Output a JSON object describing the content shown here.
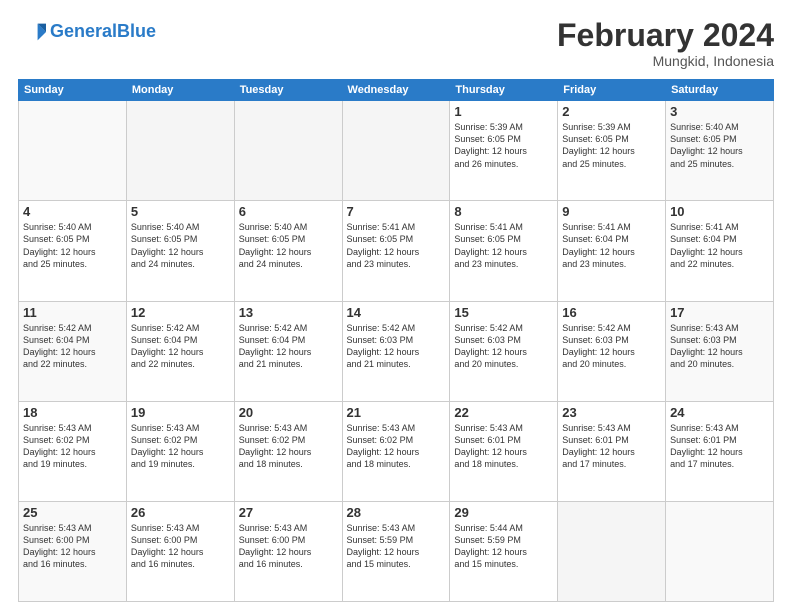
{
  "header": {
    "logo_text_general": "General",
    "logo_text_blue": "Blue",
    "month": "February 2024",
    "location": "Mungkid, Indonesia"
  },
  "days_of_week": [
    "Sunday",
    "Monday",
    "Tuesday",
    "Wednesday",
    "Thursday",
    "Friday",
    "Saturday"
  ],
  "weeks": [
    [
      {
        "day": "",
        "info": "",
        "empty": true
      },
      {
        "day": "",
        "info": "",
        "empty": true
      },
      {
        "day": "",
        "info": "",
        "empty": true
      },
      {
        "day": "",
        "info": "",
        "empty": true
      },
      {
        "day": "1",
        "info": "Sunrise: 5:39 AM\nSunset: 6:05 PM\nDaylight: 12 hours\nand 26 minutes.",
        "empty": false
      },
      {
        "day": "2",
        "info": "Sunrise: 5:39 AM\nSunset: 6:05 PM\nDaylight: 12 hours\nand 25 minutes.",
        "empty": false
      },
      {
        "day": "3",
        "info": "Sunrise: 5:40 AM\nSunset: 6:05 PM\nDaylight: 12 hours\nand 25 minutes.",
        "empty": false
      }
    ],
    [
      {
        "day": "4",
        "info": "Sunrise: 5:40 AM\nSunset: 6:05 PM\nDaylight: 12 hours\nand 25 minutes.",
        "empty": false
      },
      {
        "day": "5",
        "info": "Sunrise: 5:40 AM\nSunset: 6:05 PM\nDaylight: 12 hours\nand 24 minutes.",
        "empty": false
      },
      {
        "day": "6",
        "info": "Sunrise: 5:40 AM\nSunset: 6:05 PM\nDaylight: 12 hours\nand 24 minutes.",
        "empty": false
      },
      {
        "day": "7",
        "info": "Sunrise: 5:41 AM\nSunset: 6:05 PM\nDaylight: 12 hours\nand 23 minutes.",
        "empty": false
      },
      {
        "day": "8",
        "info": "Sunrise: 5:41 AM\nSunset: 6:05 PM\nDaylight: 12 hours\nand 23 minutes.",
        "empty": false
      },
      {
        "day": "9",
        "info": "Sunrise: 5:41 AM\nSunset: 6:04 PM\nDaylight: 12 hours\nand 23 minutes.",
        "empty": false
      },
      {
        "day": "10",
        "info": "Sunrise: 5:41 AM\nSunset: 6:04 PM\nDaylight: 12 hours\nand 22 minutes.",
        "empty": false
      }
    ],
    [
      {
        "day": "11",
        "info": "Sunrise: 5:42 AM\nSunset: 6:04 PM\nDaylight: 12 hours\nand 22 minutes.",
        "empty": false
      },
      {
        "day": "12",
        "info": "Sunrise: 5:42 AM\nSunset: 6:04 PM\nDaylight: 12 hours\nand 22 minutes.",
        "empty": false
      },
      {
        "day": "13",
        "info": "Sunrise: 5:42 AM\nSunset: 6:04 PM\nDaylight: 12 hours\nand 21 minutes.",
        "empty": false
      },
      {
        "day": "14",
        "info": "Sunrise: 5:42 AM\nSunset: 6:03 PM\nDaylight: 12 hours\nand 21 minutes.",
        "empty": false
      },
      {
        "day": "15",
        "info": "Sunrise: 5:42 AM\nSunset: 6:03 PM\nDaylight: 12 hours\nand 20 minutes.",
        "empty": false
      },
      {
        "day": "16",
        "info": "Sunrise: 5:42 AM\nSunset: 6:03 PM\nDaylight: 12 hours\nand 20 minutes.",
        "empty": false
      },
      {
        "day": "17",
        "info": "Sunrise: 5:43 AM\nSunset: 6:03 PM\nDaylight: 12 hours\nand 20 minutes.",
        "empty": false
      }
    ],
    [
      {
        "day": "18",
        "info": "Sunrise: 5:43 AM\nSunset: 6:02 PM\nDaylight: 12 hours\nand 19 minutes.",
        "empty": false
      },
      {
        "day": "19",
        "info": "Sunrise: 5:43 AM\nSunset: 6:02 PM\nDaylight: 12 hours\nand 19 minutes.",
        "empty": false
      },
      {
        "day": "20",
        "info": "Sunrise: 5:43 AM\nSunset: 6:02 PM\nDaylight: 12 hours\nand 18 minutes.",
        "empty": false
      },
      {
        "day": "21",
        "info": "Sunrise: 5:43 AM\nSunset: 6:02 PM\nDaylight: 12 hours\nand 18 minutes.",
        "empty": false
      },
      {
        "day": "22",
        "info": "Sunrise: 5:43 AM\nSunset: 6:01 PM\nDaylight: 12 hours\nand 18 minutes.",
        "empty": false
      },
      {
        "day": "23",
        "info": "Sunrise: 5:43 AM\nSunset: 6:01 PM\nDaylight: 12 hours\nand 17 minutes.",
        "empty": false
      },
      {
        "day": "24",
        "info": "Sunrise: 5:43 AM\nSunset: 6:01 PM\nDaylight: 12 hours\nand 17 minutes.",
        "empty": false
      }
    ],
    [
      {
        "day": "25",
        "info": "Sunrise: 5:43 AM\nSunset: 6:00 PM\nDaylight: 12 hours\nand 16 minutes.",
        "empty": false
      },
      {
        "day": "26",
        "info": "Sunrise: 5:43 AM\nSunset: 6:00 PM\nDaylight: 12 hours\nand 16 minutes.",
        "empty": false
      },
      {
        "day": "27",
        "info": "Sunrise: 5:43 AM\nSunset: 6:00 PM\nDaylight: 12 hours\nand 16 minutes.",
        "empty": false
      },
      {
        "day": "28",
        "info": "Sunrise: 5:43 AM\nSunset: 5:59 PM\nDaylight: 12 hours\nand 15 minutes.",
        "empty": false
      },
      {
        "day": "29",
        "info": "Sunrise: 5:44 AM\nSunset: 5:59 PM\nDaylight: 12 hours\nand 15 minutes.",
        "empty": false
      },
      {
        "day": "",
        "info": "",
        "empty": true
      },
      {
        "day": "",
        "info": "",
        "empty": true
      }
    ]
  ]
}
